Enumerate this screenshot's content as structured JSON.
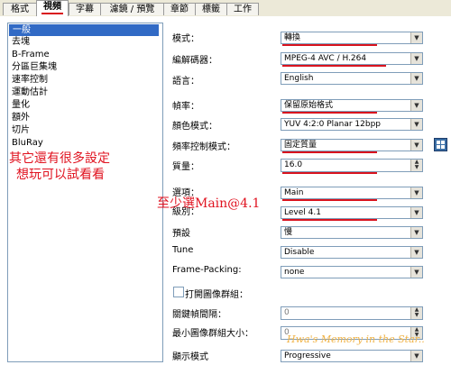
{
  "tabs": [
    "格式",
    "視頻",
    "字幕",
    "濾鏡 / 預覽",
    "章節",
    "標籤",
    "工作"
  ],
  "sidebar": {
    "items": [
      "一般",
      "去塊",
      "B-Frame",
      "分區巨集塊",
      "速率控制",
      "運動估計",
      "量化",
      "額外",
      "切片",
      "BluRay"
    ]
  },
  "annotations": {
    "note1": "其它還有很多設定",
    "note2": "想玩可以試看看",
    "note3": "至少選Main@4.1"
  },
  "form": {
    "mode_label": "模式：",
    "mode_value": "轉換",
    "encoder_label": "編解碼器：",
    "encoder_value": "MPEG-4 AVC / H.264",
    "language_label": "語言：",
    "language_value": "English",
    "framerate_label": "幀率：",
    "framerate_value": "保留原始格式",
    "colormode_label": "顏色模式：",
    "colormode_value": "YUV 4:2:0 Planar 12bpp",
    "ratecontrol_label": "頻率控制模式：",
    "ratecontrol_value": "固定質量",
    "quality_label": "質量：",
    "quality_value": "16.0",
    "profile_label": "選項：",
    "profile_value": "Main",
    "level_label": "級別：",
    "level_value": "Level 4.1",
    "preset_label": "預設",
    "preset_value": "慢",
    "tune_label": "Tune",
    "tune_value": "Disable",
    "framepacking_label": "Frame-Packing:",
    "framepacking_value": "none",
    "opengop_label": "打開圖像群組：",
    "keyint_label": "關鍵幀間隔：",
    "keyint_value": "0",
    "mingop_label": "最小圖像群組大小：",
    "mingop_value": "0",
    "display_label": "顯示模式",
    "display_value": "Progressive"
  },
  "watermark": "Hwa's Memory in the Star..",
  "colors": {
    "annotation": "#e0121f",
    "selection": "#316ac5",
    "watermark": "#f0b347"
  }
}
